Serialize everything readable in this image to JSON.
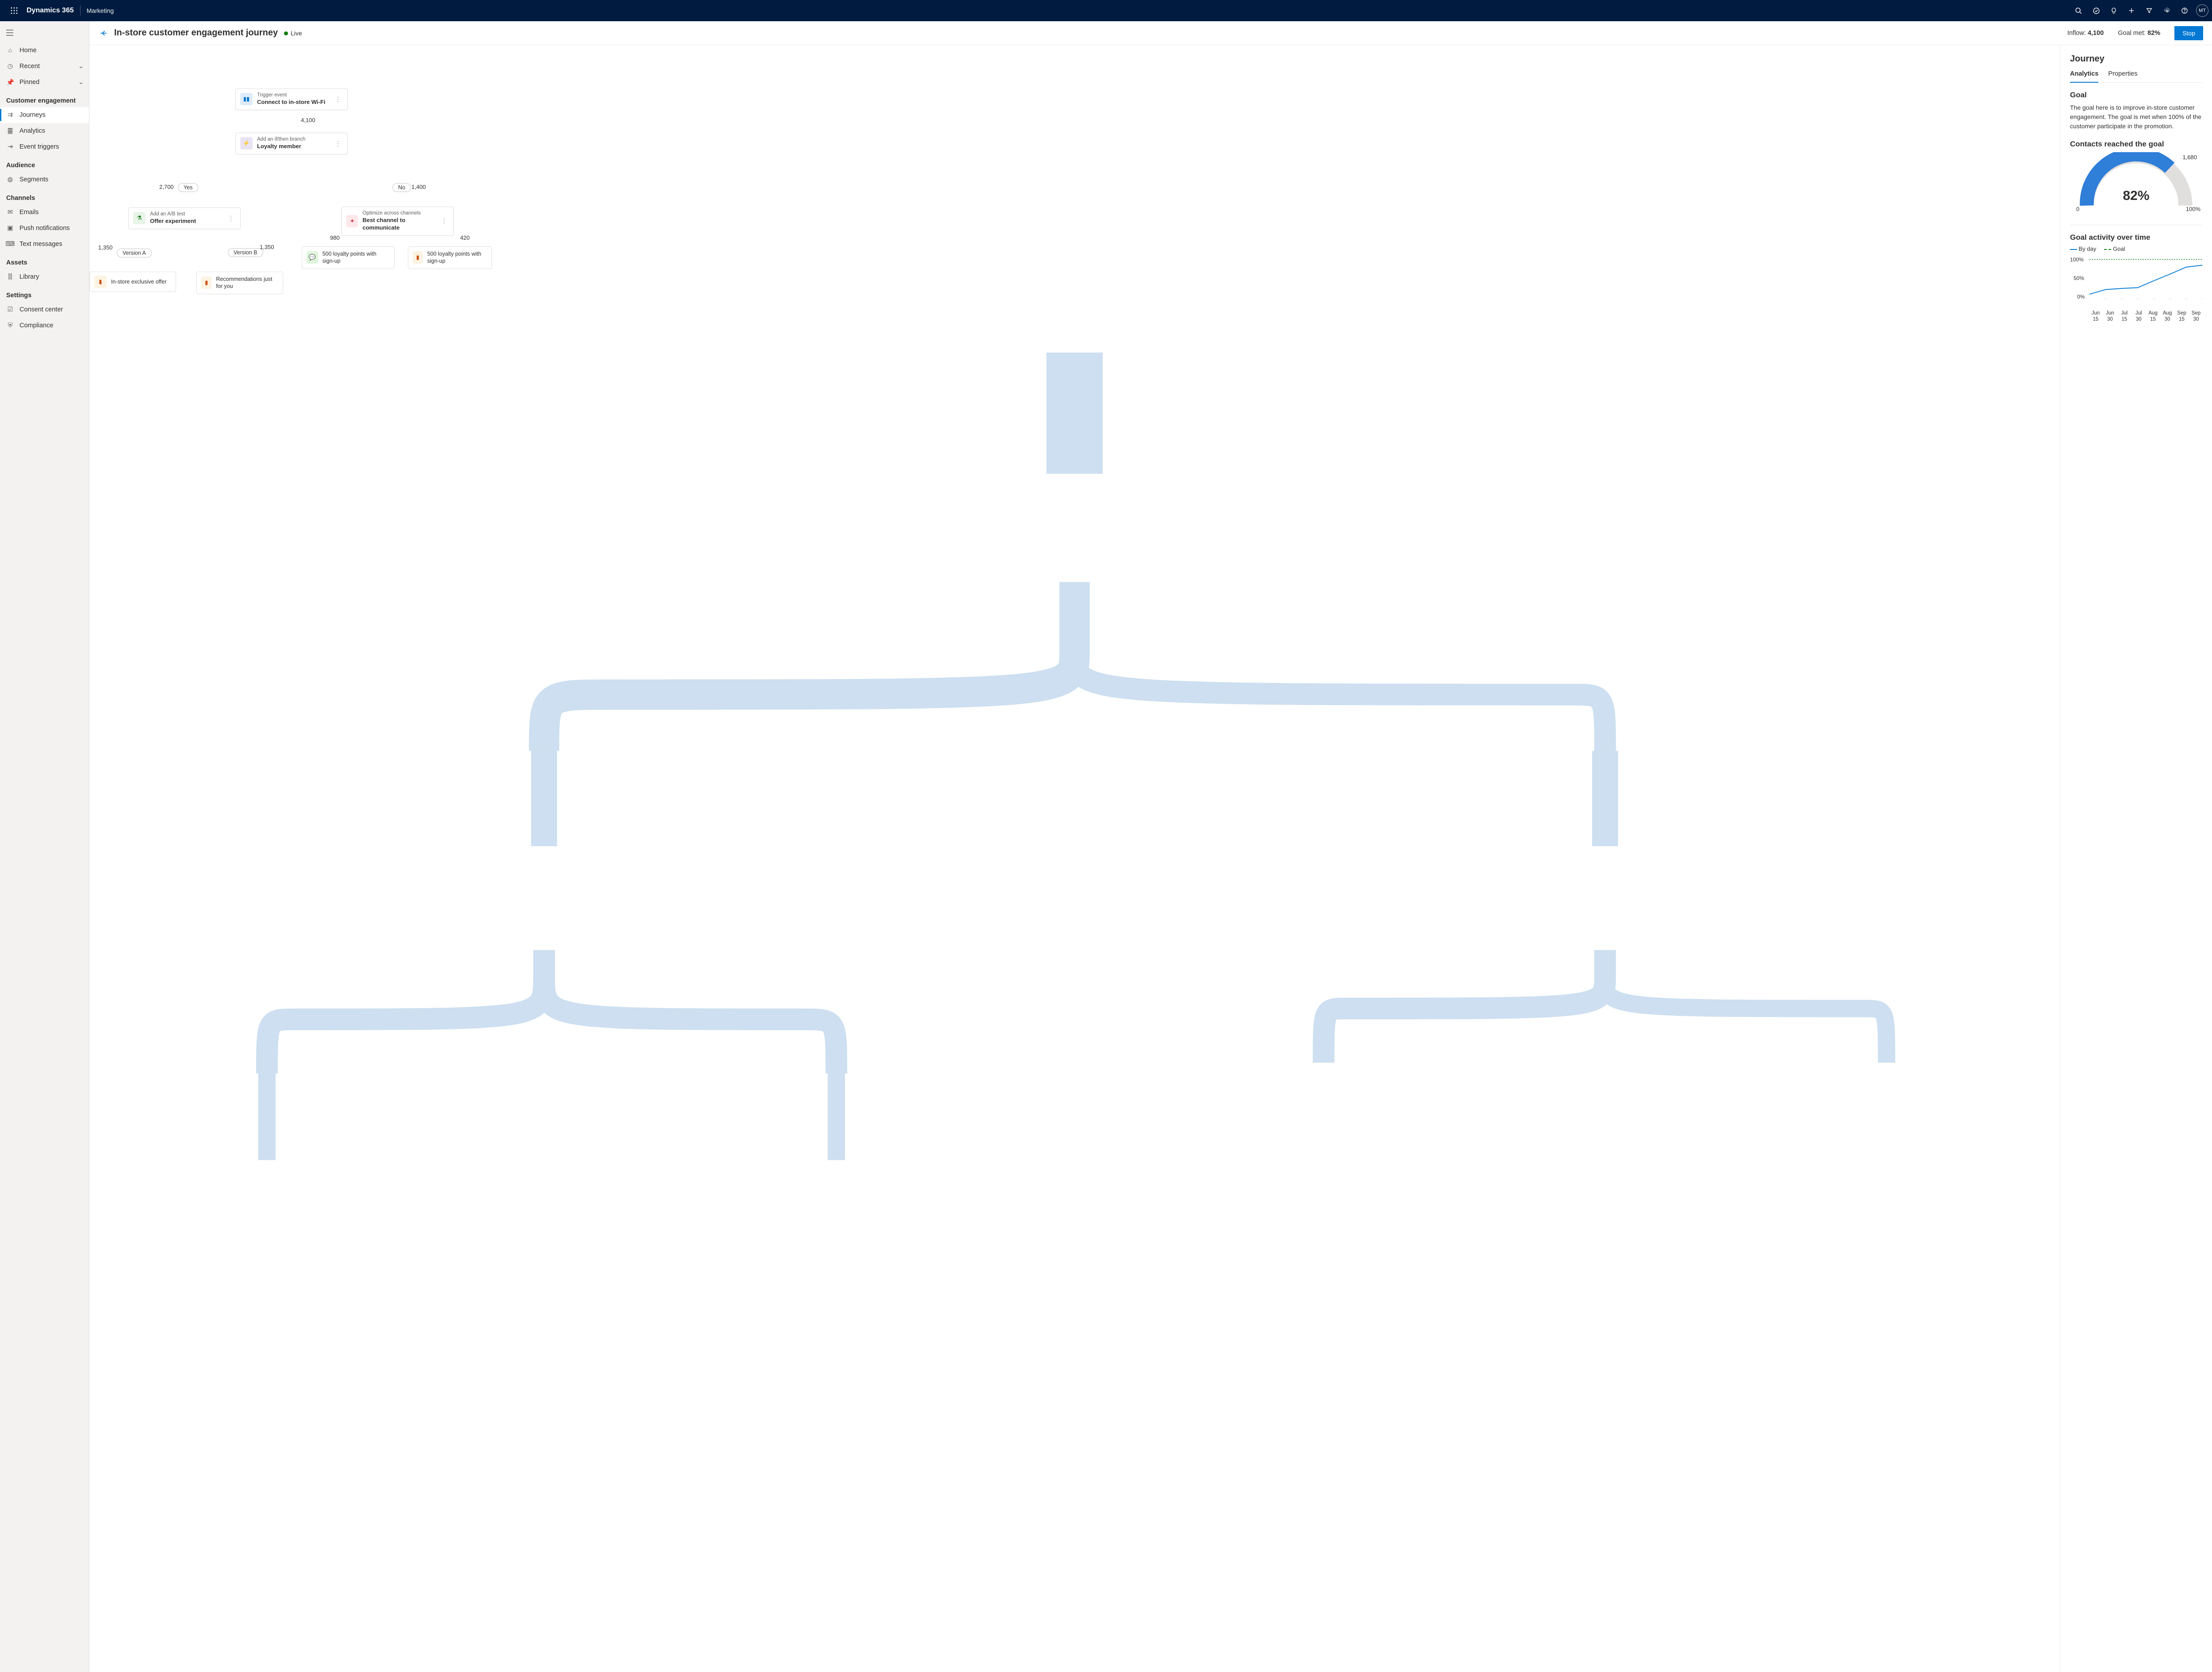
{
  "topbar": {
    "brand": "Dynamics 365",
    "area": "Marketing",
    "avatar_initials": "MT"
  },
  "nav": {
    "top": [
      {
        "key": "home",
        "label": "Home",
        "icon": "⌂"
      },
      {
        "key": "recent",
        "label": "Recent",
        "icon": "◷",
        "expandable": true
      },
      {
        "key": "pinned",
        "label": "Pinned",
        "icon": "📌",
        "expandable": true
      }
    ],
    "sections": [
      {
        "title": "Customer engagement",
        "items": [
          {
            "key": "journeys",
            "label": "Journeys",
            "icon": "⇉",
            "selected": true
          },
          {
            "key": "analytics",
            "label": "Analytics",
            "icon": "䷀"
          },
          {
            "key": "triggers",
            "label": "Event triggers",
            "icon": "⇥"
          }
        ]
      },
      {
        "title": "Audience",
        "items": [
          {
            "key": "segments",
            "label": "Segments",
            "icon": "◍"
          }
        ]
      },
      {
        "title": "Channels",
        "items": [
          {
            "key": "emails",
            "label": "Emails",
            "icon": "✉"
          },
          {
            "key": "push",
            "label": "Push notifications",
            "icon": "▣"
          },
          {
            "key": "text",
            "label": "Text messages",
            "icon": "⌨"
          }
        ]
      },
      {
        "title": "Assets",
        "items": [
          {
            "key": "library",
            "label": "Library",
            "icon": "⫿⫿"
          }
        ]
      },
      {
        "title": "Settings",
        "items": [
          {
            "key": "consent",
            "label": "Consent center",
            "icon": "☑"
          },
          {
            "key": "compliance",
            "label": "Compliance",
            "icon": "⛨"
          }
        ]
      }
    ]
  },
  "page": {
    "title": "In-store customer engagement journey",
    "status_label": "Live",
    "inflow_label": "Inflow:",
    "inflow_value": "4,100",
    "goal_met_label": "Goal met:",
    "goal_met_value": "82%",
    "stop_button": "Stop"
  },
  "flow": {
    "trigger": {
      "sub": "Trigger event",
      "title": "Connect to in-store Wi-Fi"
    },
    "inflow": "4,100",
    "branch": {
      "sub": "Add an if/then branch",
      "title": "Loyalty member"
    },
    "yes_label": "Yes",
    "yes_count": "2,700",
    "no_label": "No",
    "no_count": "1,400",
    "ab": {
      "sub": "Add an A/B test",
      "title": "Offer experiment"
    },
    "version_a": "Version A",
    "version_a_count": "1,350",
    "version_b": "Version B",
    "version_b_count": "1,350",
    "card_a": "In-store exclusive offer",
    "card_b": "Recommendations just for you",
    "optimize": {
      "sub": "Optimize across channels",
      "title": "Best channel to communicate"
    },
    "opt_left_count": "980",
    "opt_right_count": "420",
    "opt_left_title": "500 loyalty points with sign-up",
    "opt_right_title": "500 loyalty points with sign-up"
  },
  "panel": {
    "heading": "Journey",
    "tab_analytics": "Analytics",
    "tab_properties": "Properties",
    "goal_heading": "Goal",
    "goal_text": "The goal here is to improve in-store customer engagement. The goal is met when 100% of the customer participate in the promotion.",
    "reach_heading": "Contacts reached the goal",
    "gauge_top": "1,680",
    "gauge_value": "82%",
    "gauge_min": "0",
    "gauge_max": "100%",
    "activity_heading": "Goal activity over time",
    "legend_byday": "By day",
    "legend_goal": "Goal"
  },
  "chart_data": {
    "type": "line",
    "title": "Goal activity over time",
    "xlabel": "",
    "ylabel": "",
    "ylim": [
      0,
      100
    ],
    "y_ticks": [
      "0%",
      "50%",
      "100%"
    ],
    "categories": [
      "Jun 15",
      "Jun 30",
      "Jul 15",
      "Jul 30",
      "Aug 15",
      "Aug 30",
      "Sep 15",
      "Sep 30"
    ],
    "series": [
      {
        "name": "By day",
        "values": [
          10,
          22,
          25,
          27,
          45,
          62,
          80,
          85
        ]
      },
      {
        "name": "Goal",
        "values": [
          100,
          100,
          100,
          100,
          100,
          100,
          100,
          100
        ]
      }
    ],
    "goal_line_style": "dashed"
  },
  "gauge_data": {
    "type": "gauge",
    "value_pct": 82,
    "count": 1680,
    "min_label": "0",
    "max_label": "100%"
  }
}
